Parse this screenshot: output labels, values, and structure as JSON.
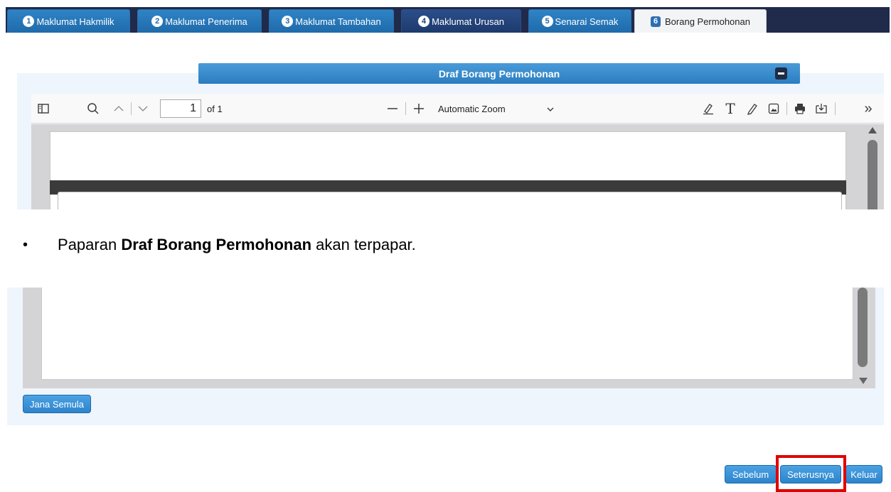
{
  "tabs": [
    {
      "num": "1",
      "label": "Maklumat Hakmilik"
    },
    {
      "num": "2",
      "label": "Maklumat Penerima"
    },
    {
      "num": "3",
      "label": "Maklumat Tambahan"
    },
    {
      "num": "4",
      "label": "Maklumat Urusan"
    },
    {
      "num": "5",
      "label": "Senarai Semak"
    },
    {
      "num": "6",
      "label": "Borang Permohonan"
    }
  ],
  "panel": {
    "title": "Draf Borang Permohonan"
  },
  "pdf_toolbar": {
    "page_number": "1",
    "page_of": "of 1",
    "zoom": "Automatic Zoom",
    "icons": [
      "sidebar-toggle-icon",
      "search-icon",
      "page-up-icon",
      "page-down-icon",
      "zoom-out-icon",
      "zoom-in-icon",
      "highlight-icon",
      "text-icon",
      "draw-icon",
      "image-icon",
      "print-icon",
      "download-icon",
      "more-tools-icon"
    ]
  },
  "caption": {
    "bullet": "•",
    "prefix": "Paparan ",
    "bold": "Draf Borang Permohonan",
    "suffix": " akan terpapar."
  },
  "buttons": {
    "jana_semula": "Jana Semula",
    "sebelum": "Sebelum",
    "seterusnya": "Seterusnya",
    "keluar": "Keluar"
  }
}
